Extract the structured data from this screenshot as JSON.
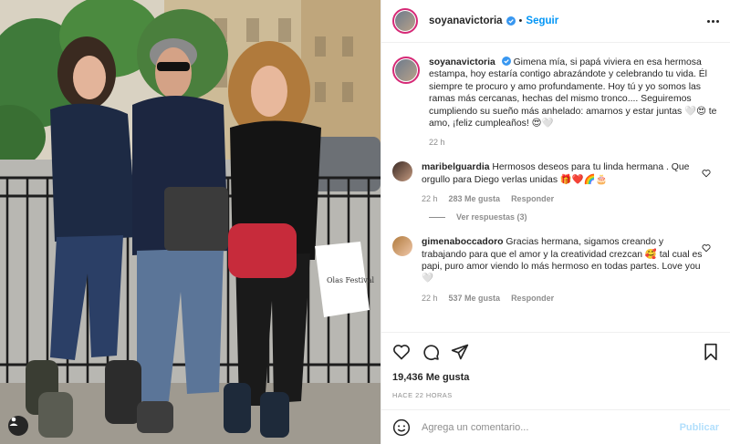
{
  "header": {
    "username": "soyanavictoria",
    "follow_label": "Seguir",
    "dot": "•"
  },
  "caption": {
    "username": "soyanavictoria",
    "text": "Gimena mía, si papá viviera en esa hermosa estampa, hoy estaría contigo abrazándote y celebrando tu vida. Él siempre te procuro y amo profundamente. Hoy tú y yo somos las ramas más cercanas, hechas del mismo tronco.... Seguiremos cumpliendo su sueño más anhelado: amarnos y estar juntas 🤍😍 te amo, ¡feliz cumpleaños! 😍🤍",
    "time": "22 h"
  },
  "comments": [
    {
      "username": "maribelguardia",
      "text": "Hermosos deseos para tu linda hermana . Que orgullo para Diego verlas unidas 🎁❤️🌈🎂",
      "time": "22 h",
      "likes": "283 Me gusta",
      "reply_label": "Responder",
      "view_replies": "Ver respuestas (3)"
    },
    {
      "username": "gimenaboccadoro",
      "text": "Gracias hermana, sigamos creando y trabajando para que el amor y la creatividad crezcan 🥰 tal cual es papi, puro amor viendo lo más hermoso en todas partes. Love you 🤍",
      "time": "22 h",
      "likes": "537 Me gusta",
      "reply_label": "Responder"
    }
  ],
  "actions": {
    "likes": "19,436 Me gusta",
    "posted": "HACE 22 HORAS"
  },
  "add_comment": {
    "placeholder": "Agrega un comentario...",
    "publish_label": "Publicar"
  },
  "photo": {
    "bag_text": "Olas Festival"
  },
  "colors": {
    "accent": "#0095f6",
    "ring": "#d62976",
    "muted": "#8e8e8e",
    "publish_disabled": "#b2dffc"
  },
  "icons": [
    "verified-icon",
    "more-icon",
    "heart-icon",
    "comment-icon",
    "share-icon",
    "save-icon",
    "emoji-icon",
    "tag-user-icon",
    "heart-small-icon"
  ]
}
